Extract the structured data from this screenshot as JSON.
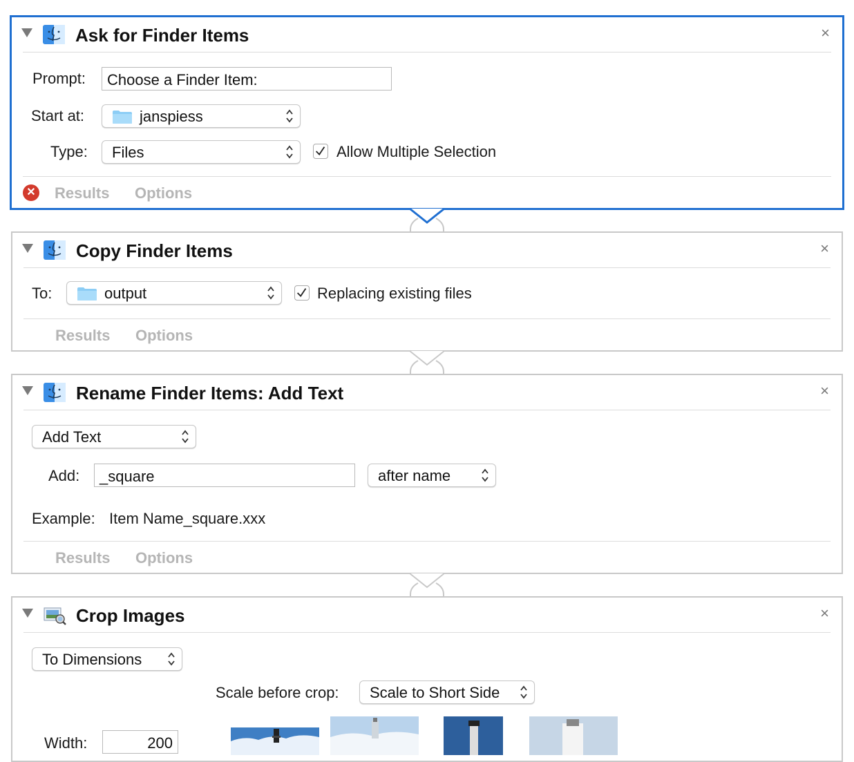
{
  "actions": [
    {
      "title": "Ask for Finder Items",
      "close": "×",
      "prompt_label": "Prompt:",
      "prompt_value": "Choose a Finder Item:",
      "start_label": "Start at:",
      "start_value": "janspiess",
      "type_label": "Type:",
      "type_value": "Files",
      "multi_label": "Allow Multiple Selection",
      "multi_checked": true,
      "results": "Results",
      "options": "Options",
      "error_icon": "error-x-icon"
    },
    {
      "title": "Copy Finder Items",
      "close": "×",
      "to_label": "To:",
      "to_value": "output",
      "replace_label": "Replacing existing files",
      "replace_checked": true,
      "results": "Results",
      "options": "Options"
    },
    {
      "title": "Rename Finder Items: Add Text",
      "close": "×",
      "mode_value": "Add Text",
      "add_label": "Add:",
      "add_value": "_square",
      "position_value": "after name",
      "example_label": "Example:",
      "example_value": "Item Name_square.xxx",
      "results": "Results",
      "options": "Options"
    },
    {
      "title": "Crop Images",
      "close": "×",
      "mode_value": "To Dimensions",
      "scale_label": "Scale before crop:",
      "scale_value": "Scale to Short Side",
      "width_label": "Width:",
      "width_value": "200"
    }
  ],
  "colors": {
    "selected_border": "#1f6fd1",
    "border": "#c8c8c8",
    "footer_text": "#b5b5b5",
    "error": "#d33a2c"
  }
}
